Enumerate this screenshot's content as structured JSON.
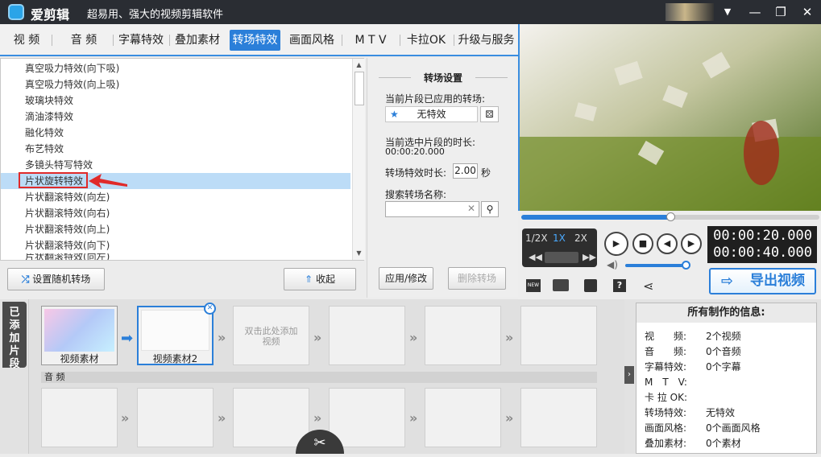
{
  "app": {
    "name": "爱剪辑",
    "slogan": "超易用、强大的视频剪辑软件"
  },
  "tabs": [
    {
      "label": "视 频"
    },
    {
      "label": "音 频"
    },
    {
      "label": "字幕特效"
    },
    {
      "label": "叠加素材"
    },
    {
      "label": "转场特效"
    },
    {
      "label": "画面风格"
    },
    {
      "label": "M T V"
    },
    {
      "label": "卡拉OK"
    },
    {
      "label": "升级与服务"
    }
  ],
  "transitions": [
    "真空吸力特效(向下吸)",
    "真空吸力特效(向上吸)",
    "玻璃块特效",
    "滴油漆特效",
    "融化特效",
    "布艺特效",
    "多镜头特写特效",
    "片状旋转特效",
    "片状翻滚特效(向左)",
    "片状翻滚特效(向右)",
    "片状翻滚特效(向上)",
    "片状翻滚特效(向下)",
    "片状翻滚特效(向左)"
  ],
  "list_buttons": {
    "random": "设置随机转场",
    "collapse": "收起"
  },
  "settings": {
    "title": "转场设置",
    "applied_label": "当前片段已应用的转场:",
    "applied_value": "无特效",
    "duration_label": "当前选中片段的时长:",
    "duration_value": "00:00:20.000",
    "effect_len_label": "转场特效时长:",
    "effect_len_value": "2.00",
    "effect_len_unit": "秒",
    "search_label": "搜索转场名称:",
    "search_placeholder": "",
    "apply_btn": "应用/修改",
    "delete_btn": "删除转场"
  },
  "player": {
    "speeds": [
      "1/2X",
      "1X",
      "2X"
    ],
    "time_current": "00:00:20.000",
    "time_total": "00:00:40.000",
    "export_label": "导出视频"
  },
  "timeline": {
    "side_label": "已添加片段",
    "clips": [
      "视频素材",
      "视频素材2"
    ],
    "placeholder": "双击此处添加视频",
    "audio_label": "音 频"
  },
  "info": {
    "title": "所有制作的信息:",
    "rows": [
      {
        "k": "视　　频:",
        "v": "2个视频"
      },
      {
        "k": "音　　频:",
        "v": "0个音频"
      },
      {
        "k": "字幕特效:",
        "v": "0个字幕"
      },
      {
        "k": "M　T　V:",
        "v": ""
      },
      {
        "k": "卡 拉 OK:",
        "v": ""
      },
      {
        "k": "转场特效:",
        "v": "无特效"
      },
      {
        "k": "画面风格:",
        "v": "0个画面风格"
      },
      {
        "k": "叠加素材:",
        "v": "0个素材"
      }
    ]
  },
  "colors": {
    "accent": "#2b7fd9",
    "highlight": "#e02a2a"
  }
}
